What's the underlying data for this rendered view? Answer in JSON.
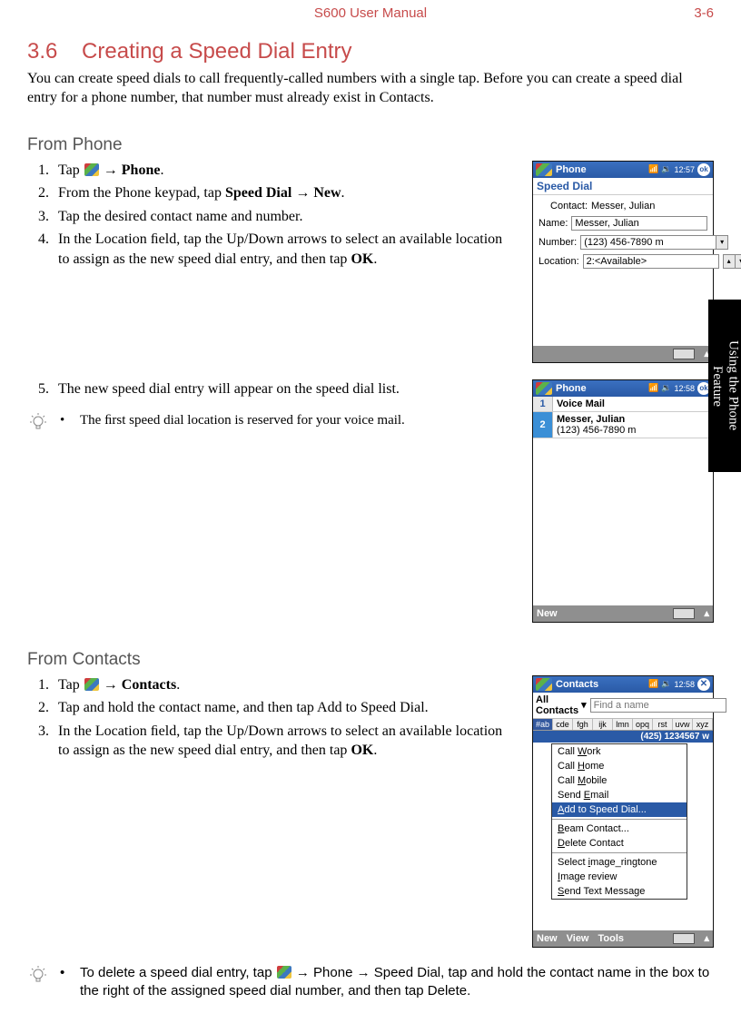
{
  "header": {
    "title": "S600 User Manual",
    "page": "3-6"
  },
  "sidetab": "Using the Phone\nFeature",
  "section": {
    "number": "3.6",
    "title": "Creating a Speed Dial Entry"
  },
  "intro": "You can create speed dials to call frequently-called numbers with a single tap. Before you can create a speed dial entry for a phone number, that number must already exist in Contacts.",
  "fromPhone": {
    "heading": "From Phone",
    "steps1": [
      {
        "pre": "Tap ",
        "flag": true,
        "post": " → ",
        "bold": "Phone",
        "tail": "."
      },
      {
        "pre": "From the Phone keypad, tap ",
        "bold": "Speed Dial → New",
        "tail": "."
      },
      {
        "pre": "Tap the desired contact name and number."
      },
      {
        "pre": "In the Location ﬁeld, tap the Up/Down arrows to select an available location to assign as the new speed dial entry, and then tap ",
        "bold": "OK",
        "tail": "."
      }
    ],
    "step5": "The new speed dial entry will appear on the speed dial list.",
    "note": "The ﬁrst speed dial location is reserved for your voice mail."
  },
  "fromContacts": {
    "heading": "From Contacts",
    "steps": [
      {
        "pre": "Tap ",
        "flag": true,
        "post": " → ",
        "bold": "Contacts",
        "tail": "."
      },
      {
        "pre": "Tap and hold the contact name, and then tap Add to Speed Dial."
      },
      {
        "pre": "In the Location ﬁeld, tap the Up/Down arrows to select an available location to assign as the new speed dial entry, and then tap ",
        "bold": "OK",
        "tail": "."
      }
    ],
    "note_pre": "To delete a speed dial entry, tap ",
    "note_post": " → Phone → Speed Dial, tap and hold the contact name in the box to the right of the assigned speed dial number, and then tap Delete."
  },
  "mock1": {
    "app": "Phone",
    "time": "12:57",
    "sub": "Speed Dial",
    "contact_label": "Contact:",
    "contact_value": "Messer, Julian",
    "name_label": "Name:",
    "name_value": "Messer, Julian",
    "number_label": "Number:",
    "number_value": "(123) 456-7890 m",
    "location_label": "Location:",
    "location_value": "2:<Available>"
  },
  "mock2": {
    "app": "Phone",
    "time": "12:58",
    "items": [
      {
        "n": "1",
        "name": "Voice Mail",
        "num": ""
      },
      {
        "n": "2",
        "name": "Messer, Julian",
        "num": "(123) 456-7890 m"
      }
    ],
    "bottom": "New"
  },
  "mock3": {
    "app": "Contacts",
    "time": "12:58",
    "filter": "All Contacts",
    "find_placeholder": "Find a name",
    "alpha": [
      "#ab",
      "cde",
      "fgh",
      "ijk",
      "lmn",
      "opq",
      "rst",
      "uvw",
      "xyz"
    ],
    "row_name": "",
    "row_right": "(425) 1234567    w",
    "menu": [
      {
        "t": "Call Work",
        "u": "W"
      },
      {
        "t": "Call Home",
        "u": "H"
      },
      {
        "t": "Call Mobile",
        "u": "M"
      },
      {
        "t": "Send Email",
        "u": "E"
      },
      {
        "t": "Add to Speed Dial...",
        "u": "A",
        "hl": true
      },
      {
        "sep": true
      },
      {
        "t": "Beam Contact...",
        "u": "B"
      },
      {
        "t": "Delete Contact",
        "u": "D"
      },
      {
        "sep": true
      },
      {
        "t": "Select image_ringtone",
        "u": "i"
      },
      {
        "t": "Image review",
        "u": "I"
      },
      {
        "t": "Send Text Message",
        "u": "S"
      }
    ],
    "bottom": [
      "New",
      "View",
      "Tools"
    ]
  }
}
